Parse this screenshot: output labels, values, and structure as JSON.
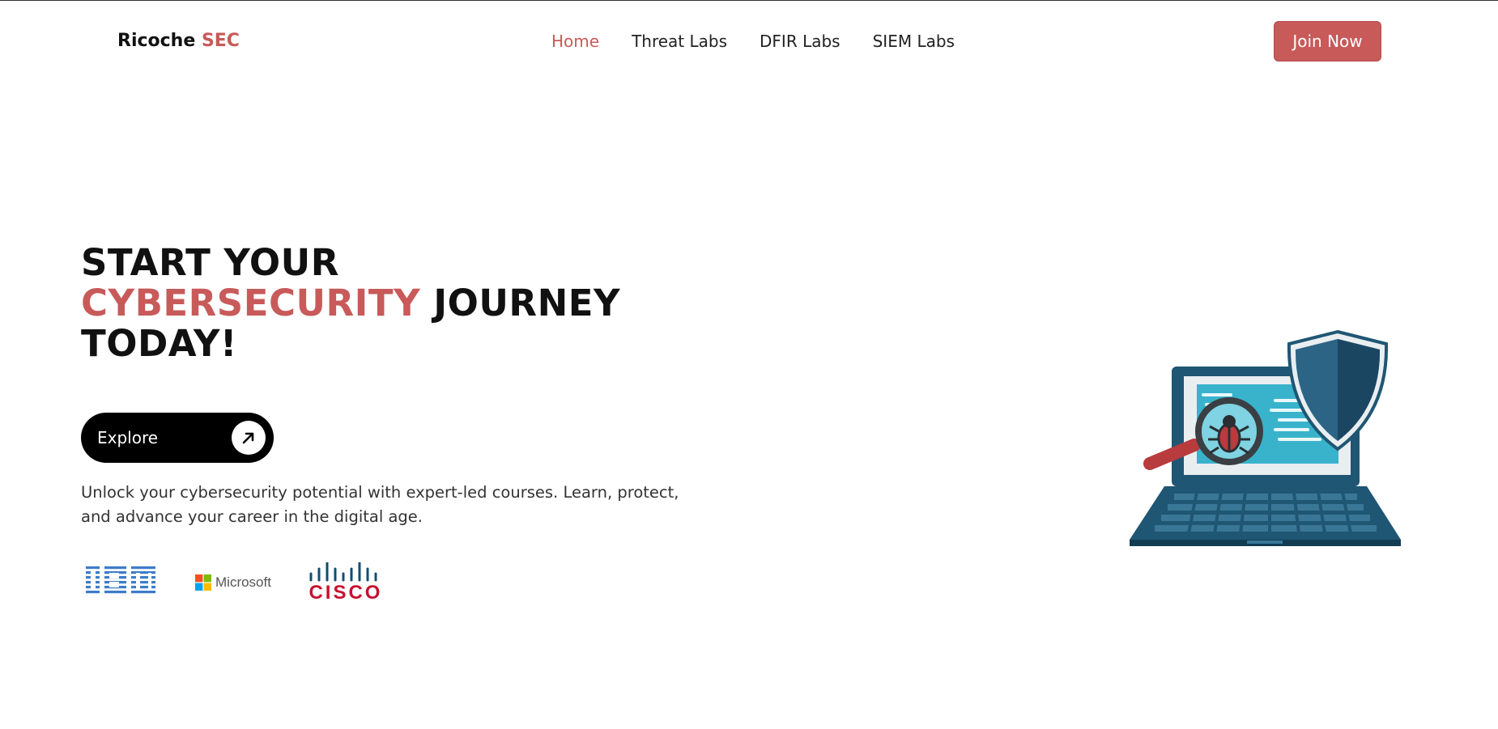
{
  "brand": {
    "name_main": "Ricoche",
    "name_accent": "SEC"
  },
  "nav": {
    "items": [
      {
        "label": "Home",
        "active": true
      },
      {
        "label": "Threat Labs",
        "active": false
      },
      {
        "label": "DFIR Labs",
        "active": false
      },
      {
        "label": "SIEM Labs",
        "active": false
      }
    ]
  },
  "header": {
    "cta_label": "Join Now"
  },
  "hero": {
    "title_line1": "START YOUR",
    "title_accent": "CYBERSECURITY",
    "title_rest_line2": "JOURNEY",
    "title_line3": "TODAY!",
    "explore_label": "Explore",
    "explore_icon": "arrow-up-right-icon",
    "description": "Unlock your cybersecurity potential with expert-led courses. Learn, protect, and advance your career in the digital age."
  },
  "partners": [
    {
      "name": "IBM",
      "icon": "ibm-logo"
    },
    {
      "name": "Microsoft",
      "icon": "microsoft-logo"
    },
    {
      "name": "cisco",
      "icon": "cisco-logo"
    }
  ],
  "colors": {
    "accent": "#c85a5a",
    "text": "#111111",
    "illustration_primary": "#1f5673",
    "illustration_screen": "#39b3cc"
  }
}
